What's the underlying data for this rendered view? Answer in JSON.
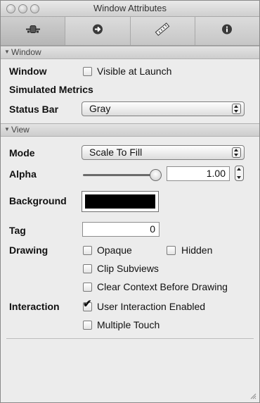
{
  "window": {
    "title": "Window Attributes"
  },
  "tabs": [
    {
      "name": "attributes",
      "icon": "attributes-slider-icon",
      "active": true
    },
    {
      "name": "connections",
      "icon": "connections-arrow-icon",
      "active": false
    },
    {
      "name": "size",
      "icon": "ruler-icon",
      "active": false
    },
    {
      "name": "identity",
      "icon": "info-icon",
      "active": false
    }
  ],
  "window_section": {
    "header": "Window",
    "window_label": "Window",
    "visible_at_launch": {
      "label": "Visible at Launch",
      "checked": false
    },
    "simulated_metrics_label": "Simulated Metrics",
    "status_bar_label": "Status Bar",
    "status_bar_value": "Gray"
  },
  "view_section": {
    "header": "View",
    "mode_label": "Mode",
    "mode_value": "Scale To Fill",
    "alpha_label": "Alpha",
    "alpha_value": "1.00",
    "alpha_level": 1.0,
    "background_label": "Background",
    "background_color": "#000000",
    "tag_label": "Tag",
    "tag_value": "0",
    "drawing_label": "Drawing",
    "opaque": {
      "label": "Opaque",
      "checked": false
    },
    "hidden": {
      "label": "Hidden",
      "checked": false
    },
    "clip_subviews": {
      "label": "Clip Subviews",
      "checked": false
    },
    "clear_context": {
      "label": "Clear Context Before Drawing",
      "checked": false
    },
    "interaction_label": "Interaction",
    "user_interaction": {
      "label": "User Interaction Enabled",
      "checked": true
    },
    "multiple_touch": {
      "label": "Multiple Touch",
      "checked": false
    }
  }
}
